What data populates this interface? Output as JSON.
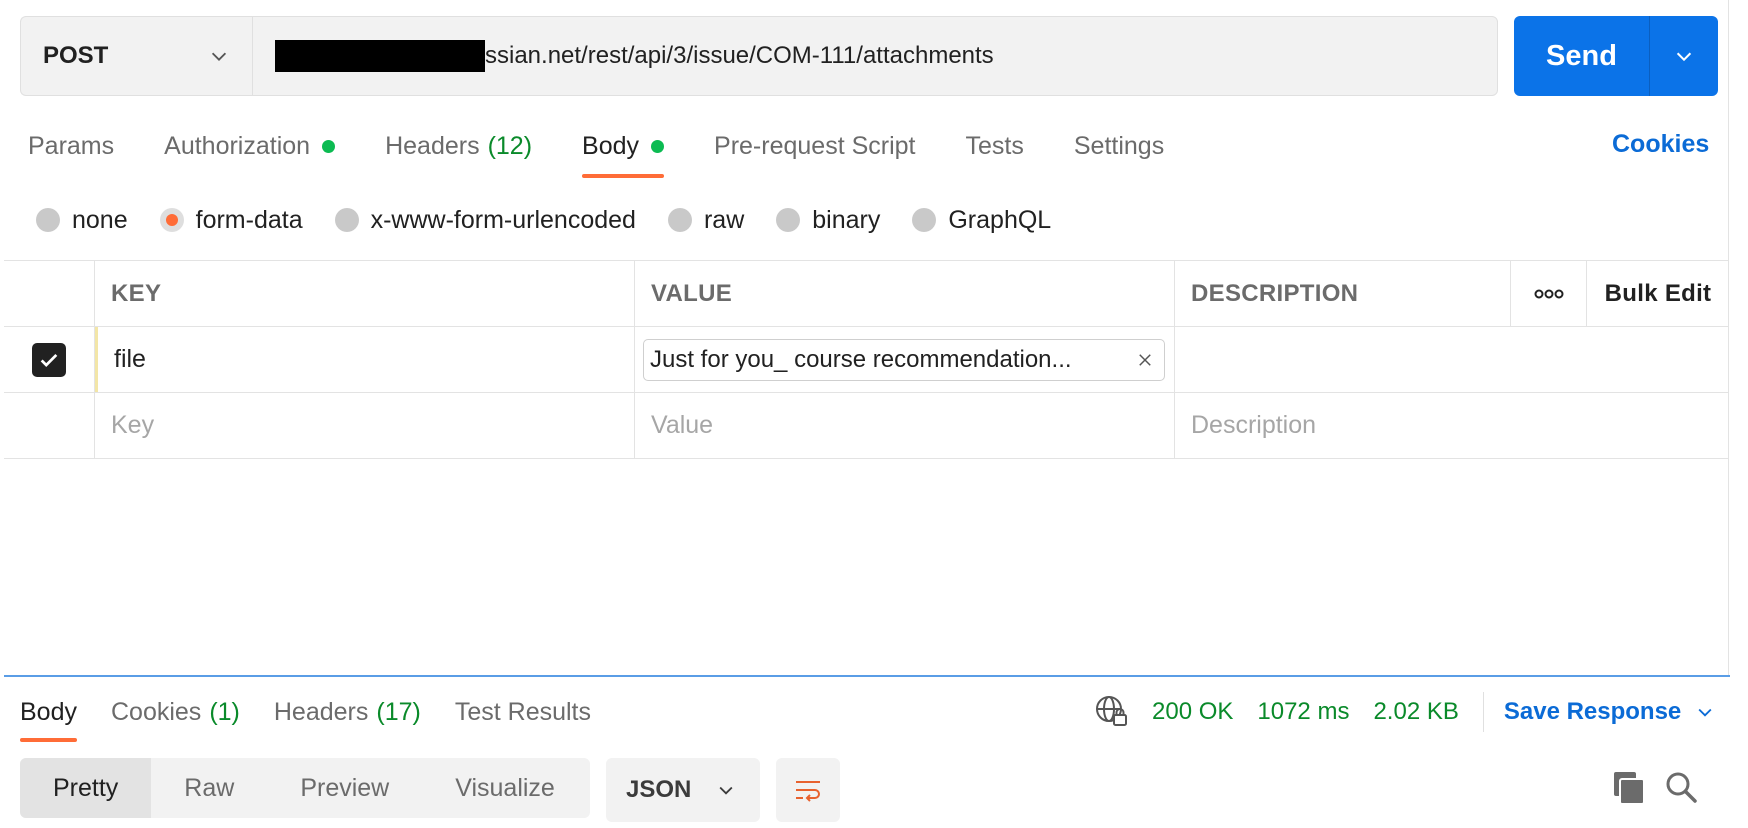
{
  "request": {
    "method": "POST",
    "url_visible": "ssian.net/rest/api/3/issue/COM-111/attachments",
    "send_label": "Send"
  },
  "tabs": {
    "params": "Params",
    "authorization": "Authorization",
    "headers": "Headers",
    "headers_count": "(12)",
    "body": "Body",
    "prerequest": "Pre-request Script",
    "tests": "Tests",
    "settings": "Settings",
    "cookies": "Cookies",
    "active": "Body"
  },
  "body_types": {
    "options": [
      "none",
      "form-data",
      "x-www-form-urlencoded",
      "raw",
      "binary",
      "GraphQL"
    ],
    "selected": "form-data"
  },
  "table": {
    "headers": {
      "key": "KEY",
      "value": "VALUE",
      "description": "DESCRIPTION",
      "more": "ooo",
      "bulk_edit": "Bulk Edit"
    },
    "rows": [
      {
        "checked": true,
        "key": "file",
        "value": "Just for you_ course recommendation...",
        "description": ""
      }
    ],
    "placeholders": {
      "key": "Key",
      "value": "Value",
      "description": "Description"
    }
  },
  "response": {
    "tabs": {
      "body": "Body",
      "cookies": "Cookies",
      "cookies_count": "(1)",
      "headers": "Headers",
      "headers_count": "(17)",
      "test_results": "Test Results",
      "active": "Body"
    },
    "status": "200 OK",
    "time": "1072 ms",
    "size": "2.02 KB",
    "save_label": "Save Response",
    "views": [
      "Pretty",
      "Raw",
      "Preview",
      "Visualize"
    ],
    "active_view": "Pretty",
    "format": "JSON"
  },
  "colors": {
    "accent_orange": "#ff6c37",
    "send_blue": "#0b73e8",
    "link_blue": "#0b6bd6",
    "status_green": "#0a8a2a",
    "dot_green": "#0cbb52"
  },
  "icons": [
    "chevron-down-icon",
    "check-icon",
    "close-icon",
    "globe-lock-icon",
    "wrap-lines-icon",
    "copy-icon",
    "search-icon"
  ]
}
